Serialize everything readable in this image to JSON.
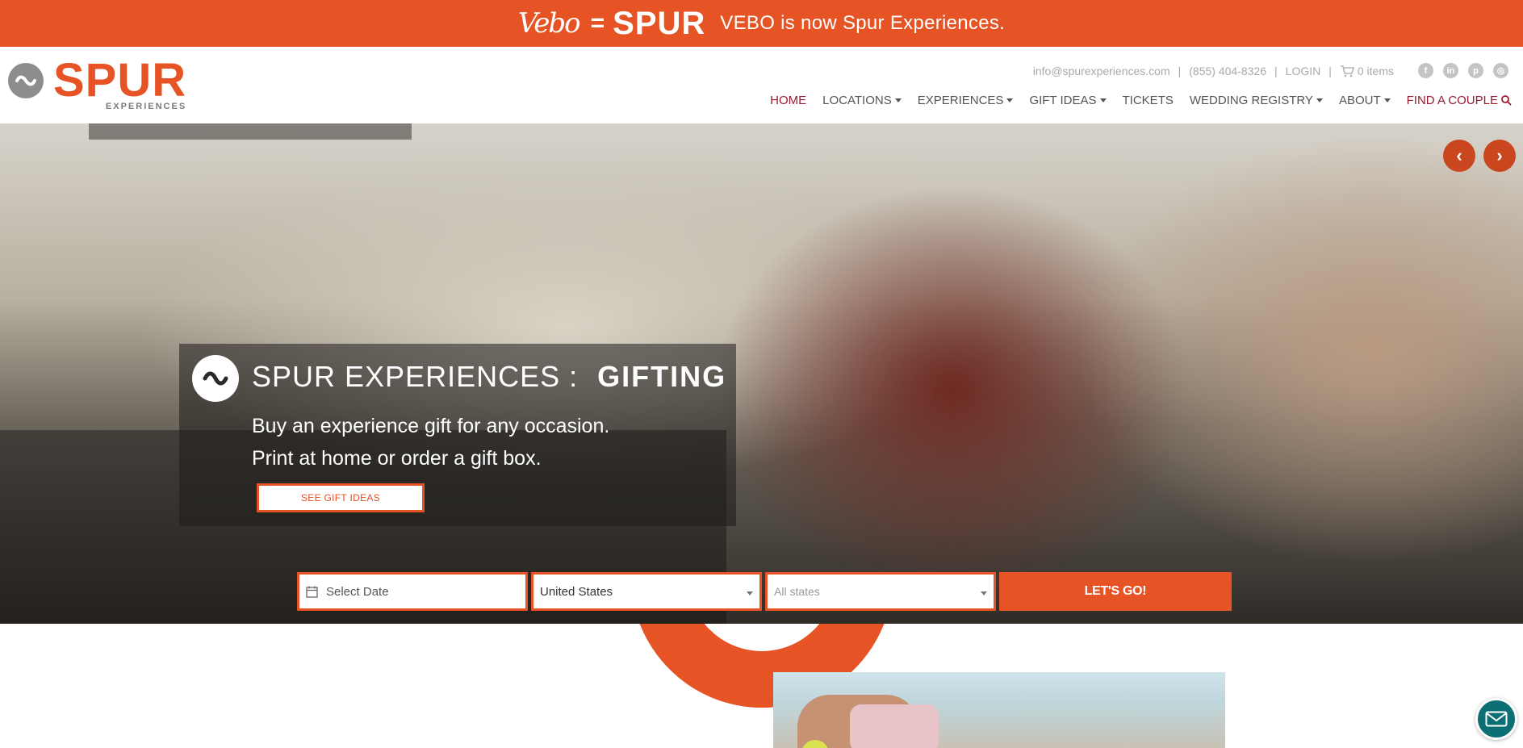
{
  "banner": {
    "vebo_logo": "Vebo",
    "equals": "=",
    "spur_logo": "SPUR",
    "message": "VEBO is now Spur Experiences."
  },
  "header": {
    "logo_name": "SPUR",
    "logo_sub": "EXPERIENCES",
    "email": "info@spurexperiences.com",
    "phone": "(855) 404-8326",
    "login": "LOGIN",
    "cart": "0 items",
    "separator": "|",
    "social_icons": [
      "facebook-icon",
      "linkedin-icon",
      "pinterest-icon",
      "instagram-icon"
    ]
  },
  "nav": {
    "items": [
      {
        "label": "HOME",
        "dropdown": false
      },
      {
        "label": "LOCATIONS",
        "dropdown": true
      },
      {
        "label": "EXPERIENCES",
        "dropdown": true
      },
      {
        "label": "GIFT IDEAS",
        "dropdown": true
      },
      {
        "label": "TICKETS",
        "dropdown": false
      },
      {
        "label": "WEDDING REGISTRY",
        "dropdown": true
      },
      {
        "label": "ABOUT",
        "dropdown": true
      },
      {
        "label": "FIND A COUPLE",
        "dropdown": false
      }
    ]
  },
  "hero": {
    "title_main": "SPUR EXPERIENCES :",
    "title_strong": "GIFTING",
    "line1": "Buy an experience gift for any occasion.",
    "line2": "Print at home or order a gift box.",
    "cta": "SEE GIFT IDEAS",
    "prev_icon": "‹",
    "next_icon": "›"
  },
  "search": {
    "date_placeholder": "Select Date",
    "country": "United States",
    "state": "All states",
    "submit": "LET'S GO!"
  },
  "colors": {
    "brand_orange": "#E65325",
    "nav_active": "#9a1b2f",
    "chat_bubble": "#0c6f73"
  }
}
